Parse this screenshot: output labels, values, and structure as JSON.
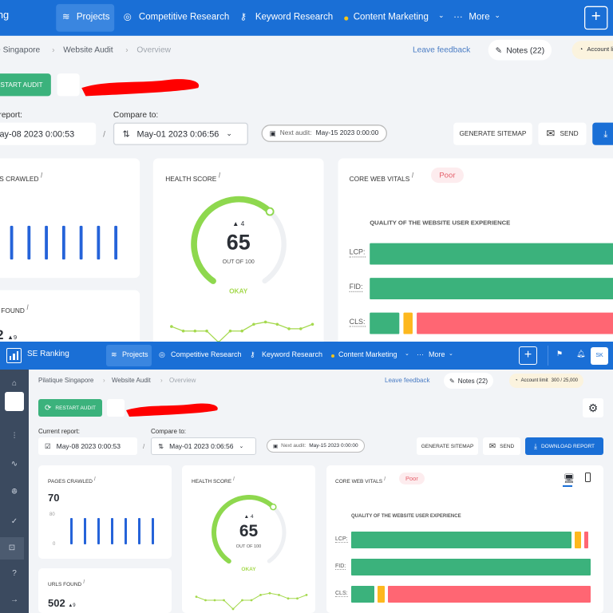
{
  "nav": {
    "brand": "SE Ranking",
    "items": [
      {
        "label": "Projects",
        "icon": "layers-icon",
        "active": true
      },
      {
        "label": "Competitive Research",
        "icon": "target-icon"
      },
      {
        "label": "Keyword Research",
        "icon": "key-icon"
      },
      {
        "label": "Content Marketing",
        "icon": "dot-icon",
        "dropdown": true
      },
      {
        "label": "More",
        "icon": "ellipsis-icon",
        "dropdown": true
      }
    ],
    "avatar": "SK"
  },
  "breadcrumb": [
    "Pilatique Singapore",
    "Website Audit",
    "Overview"
  ],
  "header": {
    "leave_feedback": "Leave feedback",
    "notes": "Notes (22)",
    "account_limit_label": "Account limit",
    "account_limit_value": "300 / 25,000"
  },
  "toolbar": {
    "restart_audit": "Restart audit",
    "current_report_label": "Current report:",
    "current_report_value": "May-08 2023 0:00:53",
    "separator": "/",
    "compare_label": "Compare to:",
    "compare_value": "May-01 2023 0:06:56",
    "next_audit_label": "Next audit:",
    "next_audit_value": "May-15 2023 0:00:00",
    "generate_sitemap": "Generate sitemap",
    "send": "Send",
    "download_report": "Download report"
  },
  "pages_crawled": {
    "title": "Pages crawled",
    "value": "70",
    "axis_max": "80",
    "axis_min": "0",
    "bars": [
      70,
      70,
      70,
      70,
      70,
      70,
      70
    ]
  },
  "urls_found": {
    "title": "URLs found",
    "value": "502",
    "delta": "9"
  },
  "health": {
    "title": "Health score",
    "score": "65",
    "score_fraction": 0.65,
    "delta": "4",
    "out_of": "OUT OF 100",
    "status": "OKAY",
    "history": [
      62,
      60,
      60,
      60,
      55,
      60,
      60,
      63,
      64,
      63,
      61,
      61,
      63
    ]
  },
  "cwv": {
    "title": "Core Web Vitals",
    "status": "Poor",
    "subtitle": "Quality of the website user experience",
    "colors": {
      "good": "#3bb27c",
      "needs_improvement": "#fdb81e",
      "poor": "#ff6673"
    },
    "rows": [
      {
        "label": "LCP:",
        "good": 92,
        "ni": 4,
        "poor": 3
      },
      {
        "label": "FID:",
        "good": 100,
        "ni": 0,
        "poor": 0
      },
      {
        "label": "CLS:",
        "good": 11,
        "ni": 4,
        "poor": 85
      }
    ]
  }
}
